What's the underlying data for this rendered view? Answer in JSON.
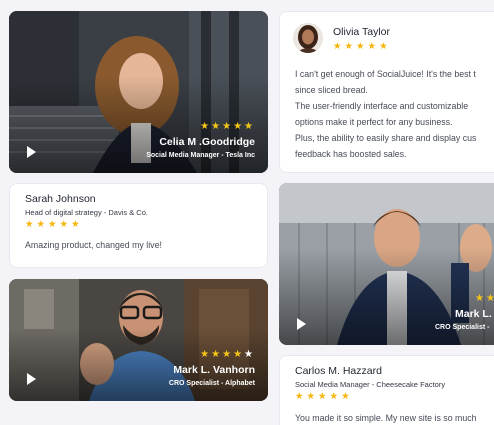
{
  "testimonials": {
    "celia": {
      "name": "Celia M .Goodridge",
      "role": "Social Media Manager - Tesla Inc",
      "stars": "★★★★★"
    },
    "olivia": {
      "name": "Olivia Taylor",
      "stars": "★★★★★",
      "lines": [
        "I can't get enough of SocialJuice! It's the best t",
        "since sliced bread.",
        "The user-friendly interface and customizable",
        "options make it perfect for any business.",
        "Plus, the ability to easily share and display cus",
        "feedback has boosted sales."
      ]
    },
    "sarah": {
      "name": "Sarah Johnson",
      "role": "Head of digital strategy - Davis & Co.",
      "stars": "★★★★★",
      "quote": "Amazing product, changed my live!"
    },
    "mark_right": {
      "name": "Mark L. V",
      "role": "CRO Specialist -",
      "stars": "★★"
    },
    "mark_left": {
      "name": "Mark L. Vanhorn",
      "role": "CRO Specialist - Alphabet",
      "stars_gold": "★★★★",
      "stars_dim": "★"
    },
    "carlos": {
      "name": "Carlos M. Hazzard",
      "role": "Social Media Manager - Cheesecake Factory",
      "stars": "★★★★★",
      "quote": "You made it so simple. My new site is so much"
    }
  },
  "icons": {
    "play": "play-icon",
    "star": "star-icon"
  },
  "colors": {
    "star_gold": "#f5c518",
    "background": "#f4f4f8"
  }
}
